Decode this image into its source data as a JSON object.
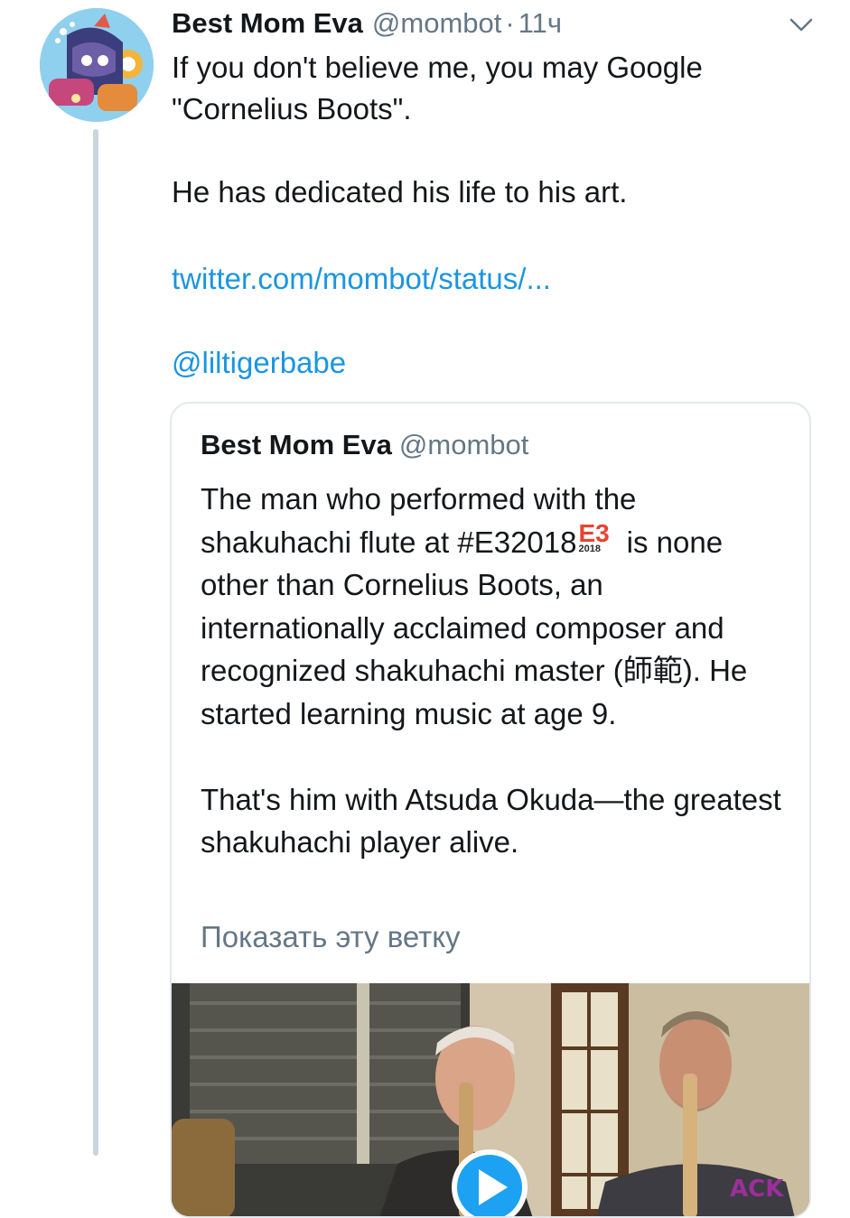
{
  "tweet": {
    "author_name": "Best Mom Eva",
    "author_handle": "@mombot",
    "separator": "·",
    "timestamp": "11ч",
    "paragraphs": [
      "If you don't believe me, you may Google \"Cornelius Boots\".",
      "He has dedicated his life to his art."
    ],
    "link_text": "twitter.com/mombot/status/...",
    "mention": "@liltigerbabe"
  },
  "quoted_tweet": {
    "author_name": "Best Mom Eva",
    "author_handle": "@mombot",
    "text_before_emoji": "The man who performed with the shakuhachi flute at #E32018",
    "emoji_main": "E3",
    "emoji_year": "2018",
    "text_after_emoji": " is none other than Cornelius Boots, an internationally acclaimed composer and recognized shakuhachi master (師範). He started learning music at age 9.",
    "paragraph_2": "That's him with Atsuda Okuda—the greatest shakuhachi player alive.",
    "show_thread": "Показать эту ветку",
    "media_overlay_text": "ACK"
  },
  "colors": {
    "link": "#1b95e0",
    "secondary_text": "#657786",
    "card_border": "#e1e8ed",
    "thread_line": "#c9d5df",
    "e3_red": "#e8432f",
    "play_button": "#1da1f2"
  },
  "icons": [
    "avatar-illustration",
    "chevron-down-icon",
    "e3-2018-emoji",
    "play-icon"
  ]
}
